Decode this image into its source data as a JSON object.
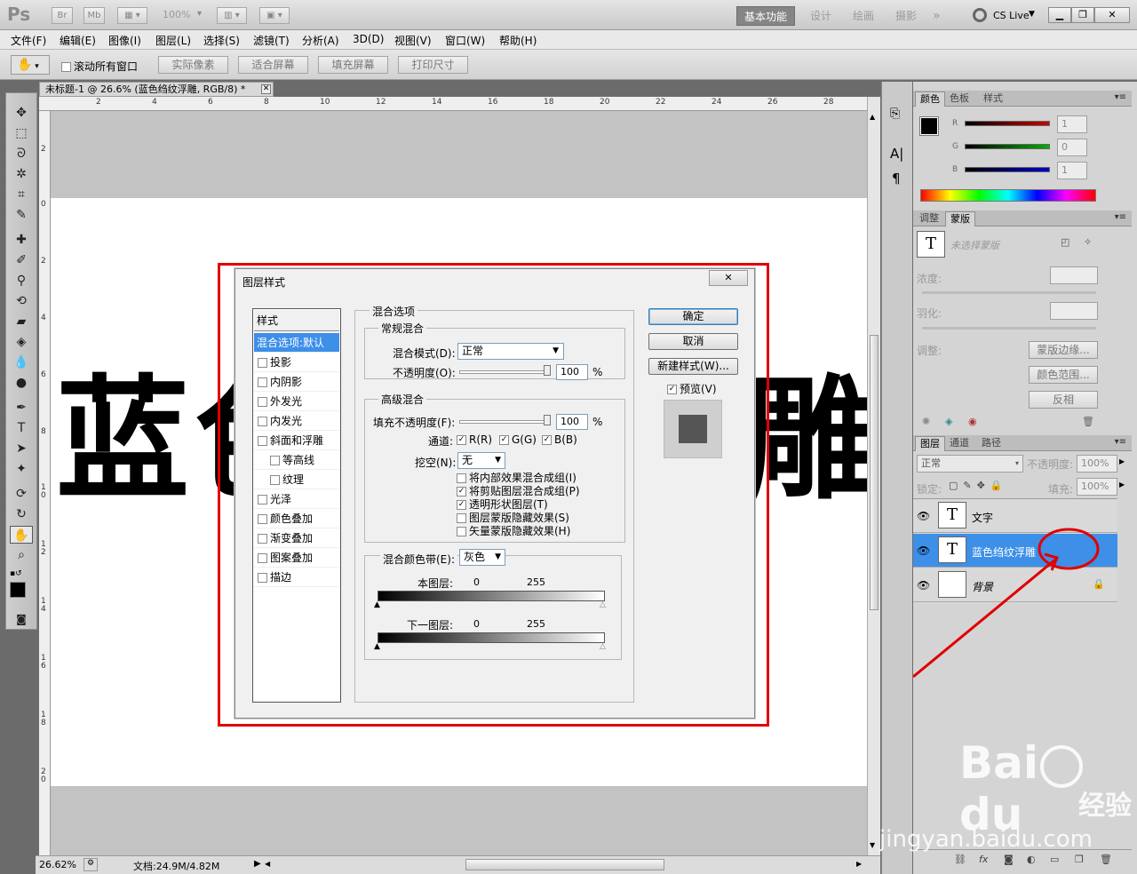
{
  "app": {
    "logo": "Ps",
    "bridge_btn": "Br",
    "minibridge_btn": "Mb",
    "zoom_combo": "100%",
    "workspaces": [
      "基本功能",
      "设计",
      "绘画",
      "摄影"
    ],
    "more": "»",
    "cs_live": "CS Live"
  },
  "menubar": [
    "文件(F)",
    "编辑(E)",
    "图像(I)",
    "图层(L)",
    "选择(S)",
    "滤镜(T)",
    "分析(A)",
    "3D(D)",
    "视图(V)",
    "窗口(W)",
    "帮助(H)"
  ],
  "options": {
    "scroll_all": "滚动所有窗口",
    "actual_pixels": "实际像素",
    "fit_screen": "适合屏幕",
    "fill_screen": "填充屏幕",
    "print_size": "打印尺寸"
  },
  "document": {
    "tab_title": "未标题-1 @ 26.6% (蓝色绉纹浮雕, RGB/8) *",
    "close": "✕",
    "ruler_top": [
      "2",
      "4",
      "6",
      "8",
      "10",
      "12",
      "14",
      "16",
      "18",
      "20",
      "22",
      "24",
      "26",
      "28"
    ],
    "ruler_left": [
      "2",
      "0",
      "2",
      "4",
      "6",
      "8",
      "1\n0",
      "1\n2",
      "1\n4",
      "1\n6",
      "1\n8",
      "2\n0"
    ],
    "canvas_text_left": "蓝色",
    "canvas_text_right": "雕",
    "zoom": "26.62%",
    "doc_info": "文档:24.9M/4.82M"
  },
  "color_panel": {
    "tabs": [
      "颜色",
      "色板",
      "样式"
    ],
    "channels": [
      {
        "label": "R",
        "value": "1",
        "color": "#cc0000"
      },
      {
        "label": "G",
        "value": "0",
        "color": "#00b000"
      },
      {
        "label": "B",
        "value": "1",
        "color": "#0000cc"
      }
    ]
  },
  "masks_panel": {
    "tabs": [
      "调整",
      "蒙版"
    ],
    "no_mask": "未选择蒙版",
    "density": "浓度:",
    "feather": "羽化:",
    "adjust": "调整:",
    "mask_edge": "蒙版边缘...",
    "color_range": "颜色范围...",
    "invert": "反相"
  },
  "layers_panel": {
    "tabs": [
      "图层",
      "通道",
      "路径"
    ],
    "blend_mode": "正常",
    "opacity_label": "不透明度:",
    "opacity": "100%",
    "lock_label": "锁定:",
    "fill_label": "填充:",
    "fill": "100%",
    "layers": [
      {
        "name": "文字",
        "thumb": "T",
        "selected": false
      },
      {
        "name": "蓝色绉纹浮雕",
        "thumb": "T",
        "selected": true
      },
      {
        "name": "背景",
        "thumb": "",
        "selected": false,
        "locked": true
      }
    ],
    "bottom_icons": [
      "link-icon",
      "fx-icon",
      "mask-icon",
      "adjustment-icon",
      "group-icon",
      "new-layer-icon",
      "trash-icon"
    ]
  },
  "dialog": {
    "title": "图层样式",
    "close": "✕",
    "styles_header": "样式",
    "styles": [
      {
        "label": "混合选项:默认",
        "checkbox": false,
        "selected": true,
        "indent": false
      },
      {
        "label": "投影",
        "checkbox": true,
        "indent": false
      },
      {
        "label": "内阴影",
        "checkbox": true,
        "indent": false
      },
      {
        "label": "外发光",
        "checkbox": true,
        "indent": false
      },
      {
        "label": "内发光",
        "checkbox": true,
        "indent": false
      },
      {
        "label": "斜面和浮雕",
        "checkbox": true,
        "indent": false
      },
      {
        "label": "等高线",
        "checkbox": true,
        "indent": true
      },
      {
        "label": "纹理",
        "checkbox": true,
        "indent": true
      },
      {
        "label": "光泽",
        "checkbox": true,
        "indent": false
      },
      {
        "label": "颜色叠加",
        "checkbox": true,
        "indent": false
      },
      {
        "label": "渐变叠加",
        "checkbox": true,
        "indent": false
      },
      {
        "label": "图案叠加",
        "checkbox": true,
        "indent": false
      },
      {
        "label": "描边",
        "checkbox": true,
        "indent": false
      }
    ],
    "blending_options": "混合选项",
    "general_blending": "常规混合",
    "blend_mode_label": "混合模式(D):",
    "blend_mode": "正常",
    "opacity_label": "不透明度(O):",
    "opacity": "100",
    "percent": "%",
    "advanced_blending": "高级混合",
    "fill_opacity_label": "填充不透明度(F):",
    "fill_opacity": "100",
    "channels_label": "通道:",
    "channels": [
      "R(R)",
      "G(G)",
      "B(B)"
    ],
    "knockout_label": "挖空(N):",
    "knockout": "无",
    "options": [
      {
        "label": "将内部效果混合成组(I)",
        "checked": false
      },
      {
        "label": "将剪贴图层混合成组(P)",
        "checked": true
      },
      {
        "label": "透明形状图层(T)",
        "checked": true
      },
      {
        "label": "图层蒙版隐藏效果(S)",
        "checked": false
      },
      {
        "label": "矢量蒙版隐藏效果(H)",
        "checked": false
      }
    ],
    "blend_if_label": "混合颜色带(E):",
    "blend_if": "灰色",
    "this_layer": "本图层:",
    "underlying": "下一图层:",
    "range_low": "0",
    "range_high": "255",
    "ok": "确定",
    "cancel": "取消",
    "new_style": "新建样式(W)...",
    "preview": "预览(V)"
  },
  "watermark": {
    "brand": "Bai",
    "brand2": "du",
    "cn": "经验",
    "url": "jingyan.baidu.com"
  }
}
